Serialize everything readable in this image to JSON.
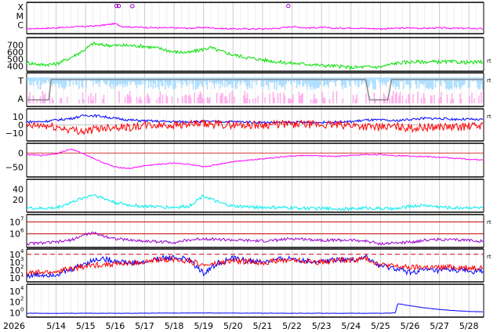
{
  "chart_data": {
    "type": "line",
    "year_label": "2026",
    "x_range": [
      "2026-05-13T00:00",
      "2026-05-28T12:00"
    ],
    "x_ticks": [
      "5/14",
      "5/15",
      "5/16",
      "5/17",
      "5/18",
      "5/19",
      "5/20",
      "5/21",
      "5/22",
      "5/23",
      "5/24",
      "5/25",
      "5/26",
      "5/27",
      "5/28"
    ],
    "grid": true,
    "colors": {
      "magenta": "#ff00ff",
      "green": "#00e000",
      "lightblue": "#aaddff",
      "pink": "#ffaaee",
      "gray": "#888888",
      "blue": "#0000ff",
      "red": "#ff0000",
      "cyan": "#00eeee",
      "purple": "#9900cc",
      "darkred": "#cc0000"
    },
    "panels": [
      {
        "id": "xray-class",
        "y_tick_labels": [
          "X",
          "M",
          "C"
        ],
        "series": [
          {
            "color": "magenta",
            "x": [
              "5/13 00:00",
              "5/13 12:00",
              "5/14 00:00",
              "5/14 12:00",
              "5/15 00:00",
              "5/15 12:00",
              "5/16 00:00",
              "5/16 06:00",
              "5/16 12:00",
              "5/17 00:00",
              "5/17 12:00",
              "5/18 00:00",
              "5/18 12:00",
              "5/19 00:00",
              "5/19 12:00",
              "5/20 00:00",
              "5/20 12:00",
              "5/21 00:00",
              "5/21 12:00",
              "5/22 00:00",
              "5/22 12:00",
              "5/23 00:00",
              "5/23 12:00",
              "5/24 00:00",
              "5/24 12:00",
              "5/25 00:00",
              "5/25 12:00",
              "5/26 00:00",
              "5/26 12:00",
              "5/27 00:00",
              "5/27 12:00",
              "5/28 00:00",
              "5/28 12:00"
            ],
            "y": [
              0.35,
              0.4,
              0.45,
              0.55,
              0.6,
              0.7,
              0.9,
              0.6,
              0.55,
              0.5,
              0.45,
              0.45,
              0.4,
              0.5,
              0.4,
              0.35,
              0.35,
              0.35,
              0.4,
              0.6,
              0.45,
              0.5,
              0.4,
              0.45,
              0.4,
              0.35,
              0.4,
              0.45,
              0.4,
              0.45,
              0.4,
              0.4,
              0.35
            ]
          }
        ],
        "markers": [
          {
            "x": "5/16 01:00",
            "y": 2.2,
            "color": "purple"
          },
          {
            "x": "5/16 03:00",
            "y": 2.2,
            "color": "purple"
          },
          {
            "x": "5/16 14:00",
            "y": 2.1,
            "color": "purple"
          },
          {
            "x": "5/21 21:00",
            "y": 2.2,
            "color": "purple"
          }
        ]
      },
      {
        "id": "solar-wind-speed",
        "y_tick_labels": [
          "700",
          "600",
          "500",
          "400"
        ],
        "y_range": [
          350,
          780
        ],
        "series": [
          {
            "color": "green",
            "x": [
              "5/13 00:00",
              "5/13 12:00",
              "5/14 00:00",
              "5/14 12:00",
              "5/15 00:00",
              "5/15 06:00",
              "5/15 12:00",
              "5/16 00:00",
              "5/16 12:00",
              "5/17 00:00",
              "5/17 12:00",
              "5/18 00:00",
              "5/18 12:00",
              "5/19 00:00",
              "5/19 06:00",
              "5/19 12:00",
              "5/20 00:00",
              "5/20 12:00",
              "5/21 00:00",
              "5/21 12:00",
              "5/22 00:00",
              "5/22 12:00",
              "5/23 00:00",
              "5/23 12:00",
              "5/24 00:00",
              "5/24 12:00",
              "5/25 00:00",
              "5/25 12:00",
              "5/26 00:00",
              "5/26 12:00",
              "5/27 00:00",
              "5/27 12:00",
              "5/28 00:00",
              "5/28 12:00"
            ],
            "y": [
              450,
              420,
              430,
              520,
              640,
              720,
              700,
              690,
              690,
              680,
              650,
              600,
              590,
              640,
              660,
              620,
              560,
              520,
              490,
              460,
              440,
              430,
              410,
              400,
              380,
              390,
              390,
              440,
              460,
              460,
              460,
              460,
              450,
              460
            ]
          }
        ]
      },
      {
        "id": "imf-direction",
        "y_tick_labels": [
          "T",
          "A"
        ],
        "y_range": [
          -1.2,
          1.2
        ],
        "series": [
          {
            "color": "gray",
            "x": [
              "5/13 00:00",
              "5/13 18:00",
              "5/13 20:00",
              "5/14 00:00",
              "5/24 12:00",
              "5/24 15:00",
              "5/25 00:00",
              "5/25 06:00",
              "5/25 09:00",
              "5/28 12:00"
            ],
            "y": [
              -0.8,
              -0.8,
              0.8,
              0.8,
              0.8,
              -0.8,
              -0.8,
              -0.8,
              0.8,
              0.8
            ]
          }
        ]
      },
      {
        "id": "imf-bz-bt",
        "y_tick_labels": [
          "10",
          "0",
          "−10"
        ],
        "y_range": [
          -18,
          18
        ],
        "series": [
          {
            "color": "blue",
            "x": [
              "5/13 00:00",
              "5/13 12:00",
              "5/14 00:00",
              "5/14 12:00",
              "5/15 00:00",
              "5/15 12:00",
              "5/16 00:00",
              "5/16 12:00",
              "5/17 00:00",
              "5/18 00:00",
              "5/19 00:00",
              "5/20 00:00",
              "5/21 00:00",
              "5/22 00:00",
              "5/23 00:00",
              "5/24 00:00",
              "5/24 12:00",
              "5/25 00:00",
              "5/25 12:00",
              "5/26 00:00",
              "5/26 12:00",
              "5/27 00:00",
              "5/27 12:00",
              "5/28 00:00",
              "5/28 12:00"
            ],
            "y": [
              4,
              4,
              6,
              8,
              12,
              11,
              8,
              6,
              5,
              4,
              4,
              4,
              3,
              3,
              3,
              4,
              6,
              6,
              5,
              7,
              8,
              8,
              7,
              7,
              6
            ]
          },
          {
            "color": "red",
            "x": [
              "5/13 00:00",
              "5/13 12:00",
              "5/14 00:00",
              "5/14 12:00",
              "5/15 00:00",
              "5/15 12:00",
              "5/16 00:00",
              "5/16 12:00",
              "5/17 00:00",
              "5/18 00:00",
              "5/19 00:00",
              "5/20 00:00",
              "5/21 00:00",
              "5/22 00:00",
              "5/23 00:00",
              "5/24 00:00",
              "5/24 12:00",
              "5/25 00:00",
              "5/25 12:00",
              "5/26 00:00",
              "5/26 12:00",
              "5/27 00:00",
              "5/27 12:00",
              "5/28 00:00",
              "5/28 12:00"
            ],
            "y": [
              -2,
              -1,
              -3,
              -6,
              -8,
              -4,
              -2,
              -3,
              -1,
              0,
              1,
              0,
              0,
              1,
              0,
              0,
              -2,
              -3,
              -2,
              -4,
              -3,
              -2,
              -3,
              -2,
              -1
            ]
          }
        ]
      },
      {
        "id": "dst",
        "y_tick_labels": [
          "0",
          "−50"
        ],
        "y_range": [
          -80,
          30
        ],
        "series": [
          {
            "color": "magenta",
            "x": [
              "5/13 00:00",
              "5/13 12:00",
              "5/14 00:00",
              "5/14 12:00",
              "5/15 00:00",
              "5/15 12:00",
              "5/16 00:00",
              "5/16 12:00",
              "5/17 00:00",
              "5/17 12:00",
              "5/18 00:00",
              "5/18 12:00",
              "5/19 00:00",
              "5/19 12:00",
              "5/20 00:00",
              "5/20 12:00",
              "5/21 00:00",
              "5/21 12:00",
              "5/22 00:00",
              "5/22 12:00",
              "5/23 00:00",
              "5/23 12:00",
              "5/24 00:00",
              "5/24 12:00",
              "5/25 00:00",
              "5/25 12:00",
              "5/26 00:00",
              "5/26 12:00",
              "5/27 00:00",
              "5/27 12:00",
              "5/28 00:00",
              "5/28 12:00"
            ],
            "y": [
              -5,
              -8,
              -2,
              15,
              -5,
              -30,
              -50,
              -55,
              -45,
              -40,
              -35,
              -40,
              -50,
              -40,
              -30,
              -25,
              -20,
              -15,
              -10,
              -8,
              -10,
              -12,
              -8,
              -5,
              -5,
              -8,
              -10,
              -12,
              -15,
              -18,
              -22,
              -25
            ]
          }
        ]
      },
      {
        "id": "density",
        "y_tick_labels": [
          "40",
          "20"
        ],
        "y_range": [
          0,
          55
        ],
        "series": [
          {
            "color": "cyan",
            "x": [
              "5/13 00:00",
              "5/13 12:00",
              "5/14 00:00",
              "5/14 12:00",
              "5/15 00:00",
              "5/15 06:00",
              "5/15 12:00",
              "5/16 00:00",
              "5/16 12:00",
              "5/17 00:00",
              "5/18 00:00",
              "5/18 12:00",
              "5/19 00:00",
              "5/19 12:00",
              "5/20 00:00",
              "5/21 00:00",
              "5/22 00:00",
              "5/23 00:00",
              "5/24 00:00",
              "5/24 12:00",
              "5/25 00:00",
              "5/25 12:00",
              "5/26 00:00",
              "5/26 12:00",
              "5/27 00:00",
              "5/27 12:00",
              "5/28 00:00",
              "5/28 12:00"
            ],
            "y": [
              5,
              4,
              5,
              15,
              25,
              30,
              25,
              15,
              10,
              8,
              6,
              8,
              28,
              15,
              8,
              6,
              5,
              4,
              3,
              5,
              4,
              3,
              8,
              10,
              7,
              5,
              6,
              5
            ]
          }
        ]
      },
      {
        "id": "electron-flux",
        "y_tick_labels": [
          "10^7",
          "10^6"
        ],
        "y_scale": "log",
        "y_range": [
          100000,
          30000000
        ],
        "reference_lines": [
          10000000,
          1000000
        ],
        "series": [
          {
            "color": "purple",
            "x": [
              "5/13 00:00",
              "5/14 00:00",
              "5/14 12:00",
              "5/15 00:00",
              "5/15 06:00",
              "5/15 12:00",
              "5/16 00:00",
              "5/16 12:00",
              "5/17 00:00",
              "5/18 00:00",
              "5/18 12:00",
              "5/19 00:00",
              "5/19 12:00",
              "5/20 00:00",
              "5/21 00:00",
              "5/21 12:00",
              "5/22 00:00",
              "5/22 12:00",
              "5/23 00:00",
              "5/24 00:00",
              "5/24 12:00",
              "5/25 00:00",
              "5/26 00:00",
              "5/26 12:00",
              "5/27 00:00",
              "5/27 12:00",
              "5/28 00:00",
              "5/28 12:00"
            ],
            "y": [
              150000,
              200000,
              300000,
              900000,
              1200000,
              800000,
              400000,
              300000,
              250000,
              200000,
              300000,
              400000,
              350000,
              300000,
              250000,
              300000,
              400000,
              350000,
              300000,
              300000,
              250000,
              150000,
              200000,
              300000,
              350000,
              300000,
              300000,
              250000
            ]
          }
        ]
      },
      {
        "id": "proton-flux",
        "y_tick_labels": [
          "10^4",
          "10^3",
          "10^2",
          "10^1"
        ],
        "y_scale": "log",
        "y_range": [
          5,
          30000
        ],
        "reference_lines": [
          10000
        ],
        "series": [
          {
            "color": "blue",
            "x": [
              "5/13 00:00",
              "5/14 00:00",
              "5/14 12:00",
              "5/15 00:00",
              "5/15 12:00",
              "5/16 00:00",
              "5/16 12:00",
              "5/17 00:00",
              "5/17 12:00",
              "5/18 00:00",
              "5/18 12:00",
              "5/19 00:00",
              "5/19 12:00",
              "5/20 00:00",
              "5/20 12:00",
              "5/21 00:00",
              "5/21 12:00",
              "5/22 00:00",
              "5/22 12:00",
              "5/23 00:00",
              "5/23 12:00",
              "5/24 00:00",
              "5/24 12:00",
              "5/25 00:00",
              "5/25 12:00",
              "5/26 00:00",
              "5/26 12:00",
              "5/27 00:00",
              "5/27 12:00",
              "5/28 00:00",
              "5/28 12:00"
            ],
            "y": [
              20,
              30,
              100,
              800,
              3000,
              1500,
              800,
              900,
              3000,
              4000,
              2000,
              40,
              800,
              3000,
              1500,
              1000,
              2000,
              3000,
              1500,
              1200,
              2500,
              2000,
              4000,
              300,
              150,
              50,
              100,
              80,
              120,
              60,
              80
            ]
          },
          {
            "color": "red",
            "x": [
              "5/13 00:00",
              "5/14 00:00",
              "5/14 12:00",
              "5/15 00:00",
              "5/15 12:00",
              "5/16 00:00",
              "5/16 12:00",
              "5/17 00:00",
              "5/17 12:00",
              "5/18 00:00",
              "5/18 12:00",
              "5/19 00:00",
              "5/19 12:00",
              "5/20 00:00",
              "5/20 12:00",
              "5/21 00:00",
              "5/21 12:00",
              "5/22 00:00",
              "5/22 12:00",
              "5/23 00:00",
              "5/23 12:00",
              "5/24 00:00",
              "5/24 12:00",
              "5/25 00:00",
              "5/25 12:00",
              "5/26 00:00",
              "5/26 12:00",
              "5/27 00:00",
              "5/27 12:00",
              "5/28 00:00",
              "5/28 12:00"
            ],
            "y": [
              40,
              60,
              150,
              300,
              500,
              600,
              700,
              1000,
              2000,
              2500,
              1500,
              400,
              700,
              1500,
              1200,
              900,
              1500,
              2000,
              1300,
              1000,
              1800,
              1800,
              3000,
              500,
              300,
              200,
              250,
              200,
              250,
              200,
              250
            ]
          }
        ]
      },
      {
        "id": "high-energy-proton",
        "y_tick_labels": [
          "10^4",
          "10^2",
          "10^0"
        ],
        "y_scale": "log",
        "y_range": [
          0.3,
          100000
        ],
        "series": [
          {
            "color": "blue",
            "x": [
              "5/13 00:00",
              "5/16 00:00",
              "5/19 00:00",
              "5/22 00:00",
              "5/25 00:00",
              "5/25 12:00",
              "5/25 14:00",
              "5/26 00:00",
              "5/26 12:00",
              "5/27 00:00",
              "5/27 12:00",
              "5/28 00:00",
              "5/28 12:00"
            ],
            "y": [
              0.8,
              0.8,
              0.9,
              0.8,
              0.8,
              0.9,
              50,
              20,
              8,
              4,
              2.5,
              1.8,
              1.4
            ]
          }
        ]
      }
    ],
    "right_markers": [
      {
        "panel": "solar-wind-speed",
        "text": "rt"
      },
      {
        "panel": "imf-direction",
        "text": "rt"
      },
      {
        "panel": "imf-bz-bt",
        "text": "rt"
      },
      {
        "panel": "electron-flux",
        "text": "rt"
      },
      {
        "panel": "proton-flux",
        "text": "rt"
      }
    ]
  }
}
